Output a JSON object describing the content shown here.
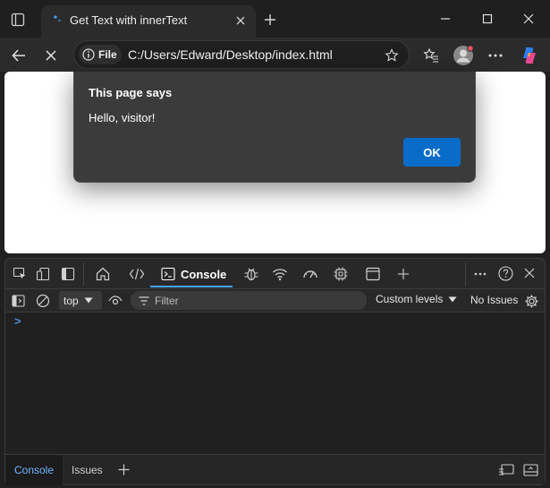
{
  "browser": {
    "tab_title": "Get Text with innerText",
    "address": {
      "scheme_label": "File",
      "url": "C:/Users/Edward/Desktop/index.html"
    }
  },
  "dialog": {
    "title": "This page says",
    "message": "Hello, visitor!",
    "ok_label": "OK"
  },
  "devtools": {
    "tabs": {
      "console_label": "Console"
    },
    "toolbar": {
      "context": "top",
      "filter_placeholder": "Filter",
      "levels_label": "Custom levels",
      "issues_label": "No Issues"
    },
    "console": {
      "prompt_symbol": ">"
    },
    "drawer": {
      "console_label": "Console",
      "issues_label": "Issues"
    }
  },
  "colors": {
    "accent": "#0a6cc9",
    "active_tab_underline": "#4aa3ff",
    "profile_badge": "#e8565b"
  }
}
